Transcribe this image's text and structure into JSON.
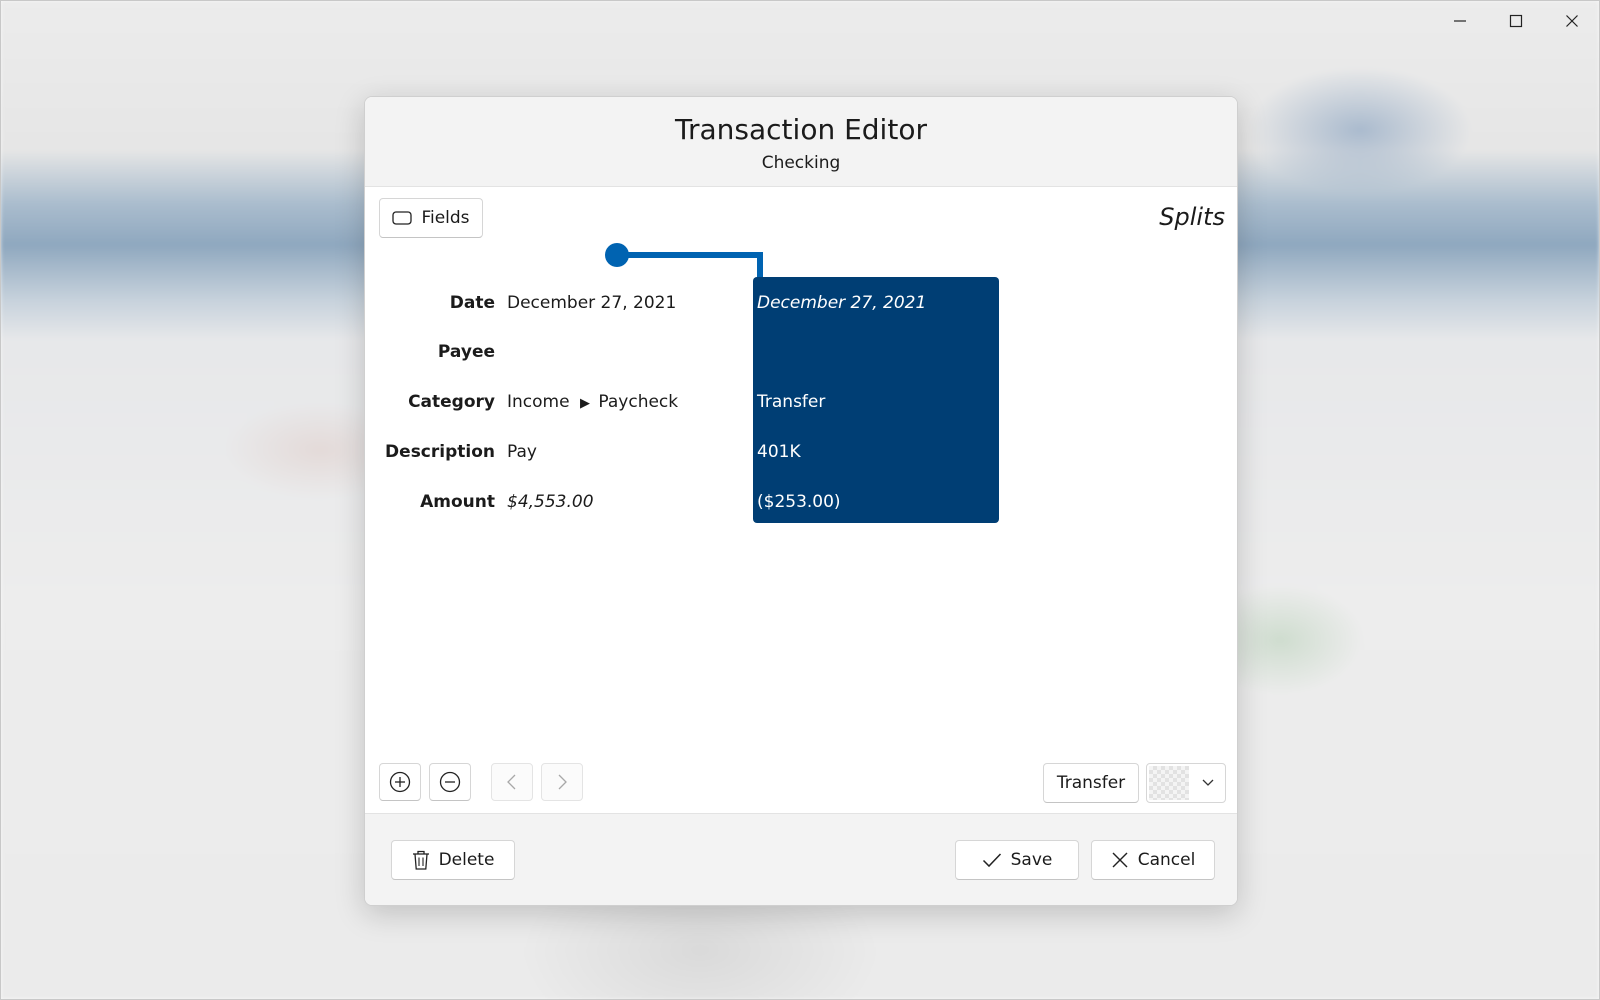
{
  "window": {
    "minimize_icon": "minimize-icon",
    "maximize_icon": "maximize-icon",
    "close_icon": "close-icon"
  },
  "dialog": {
    "title": "Transaction Editor",
    "subtitle": "Checking"
  },
  "toolbar": {
    "fields_label": "Fields",
    "splits_label": "Splits"
  },
  "transaction": {
    "date_label": "Date",
    "date_value": "December 27, 2021",
    "payee_label": "Payee",
    "payee_value": "",
    "category_label": "Category",
    "category_parent": "Income",
    "category_child": "Paycheck",
    "description_label": "Description",
    "description_value": "Pay",
    "amount_label": "Amount",
    "amount_value": "$4,553.00"
  },
  "split": {
    "date": "December 27, 2021",
    "payee": "",
    "category": "Transfer",
    "description": "401K",
    "amount": "($253.00)"
  },
  "split_controls": {
    "add_icon": "plus-circle-icon",
    "remove_icon": "minus-circle-icon",
    "prev_icon": "chevron-left-icon",
    "next_icon": "chevron-right-icon",
    "transfer_label": "Transfer"
  },
  "footer": {
    "delete_label": "Delete",
    "save_label": "Save",
    "cancel_label": "Cancel"
  },
  "colors": {
    "split_background": "#003e74",
    "accent": "#0063b1"
  }
}
